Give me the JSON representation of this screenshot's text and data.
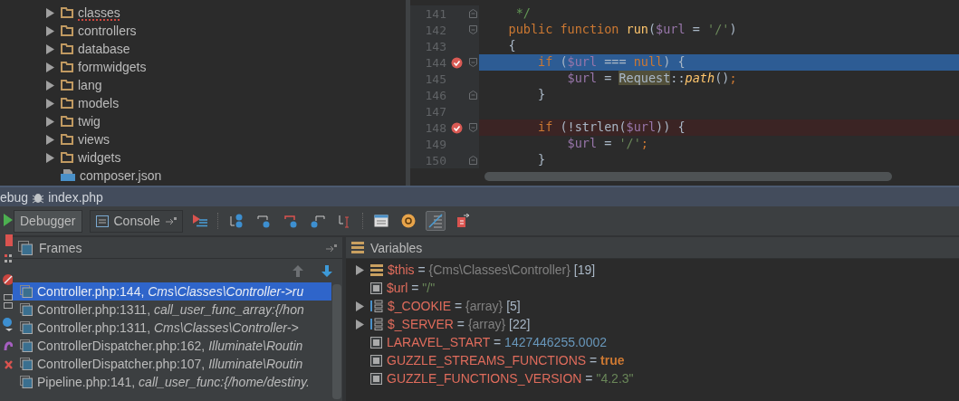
{
  "project_tree": {
    "items": [
      {
        "label": "classes",
        "kind": "folder",
        "misspelled": true
      },
      {
        "label": "controllers",
        "kind": "folder",
        "misspelled": false
      },
      {
        "label": "database",
        "kind": "folder",
        "misspelled": false
      },
      {
        "label": "formwidgets",
        "kind": "folder",
        "misspelled": false
      },
      {
        "label": "lang",
        "kind": "folder",
        "misspelled": false
      },
      {
        "label": "models",
        "kind": "folder",
        "misspelled": false
      },
      {
        "label": "twig",
        "kind": "folder",
        "misspelled": false
      },
      {
        "label": "views",
        "kind": "folder",
        "misspelled": false
      },
      {
        "label": "widgets",
        "kind": "folder",
        "misspelled": false
      },
      {
        "label": "composer.json",
        "kind": "json",
        "misspelled": false
      }
    ]
  },
  "editor": {
    "lines": [
      {
        "number": "141",
        "fold_start": false,
        "fold_end": true,
        "breakpoint": false,
        "current": false,
        "tokens": [
          {
            "kind": "comment",
            "text": "     */"
          }
        ]
      },
      {
        "number": "142",
        "fold_start": true,
        "fold_end": false,
        "breakpoint": false,
        "current": false,
        "tokens": [
          {
            "kind": "keyword",
            "text": "    public function "
          },
          {
            "kind": "func",
            "text": "run"
          },
          {
            "kind": "plain",
            "text": "("
          },
          {
            "kind": "var",
            "text": "$url"
          },
          {
            "kind": "plain",
            "text": " = "
          },
          {
            "kind": "string",
            "text": "'/'"
          },
          {
            "kind": "plain",
            "text": ")"
          }
        ]
      },
      {
        "number": "143",
        "fold_start": false,
        "fold_end": false,
        "breakpoint": false,
        "current": false,
        "tokens": [
          {
            "kind": "plain",
            "text": "    {"
          }
        ]
      },
      {
        "number": "144",
        "fold_start": true,
        "fold_end": false,
        "breakpoint": true,
        "current": true,
        "tokens": [
          {
            "kind": "keyword",
            "text": "        if"
          },
          {
            "kind": "plain",
            "text": " ("
          },
          {
            "kind": "var",
            "text": "$url"
          },
          {
            "kind": "plain",
            "text": " === "
          },
          {
            "kind": "keyword",
            "text": "null"
          },
          {
            "kind": "plain",
            "text": ") {"
          }
        ]
      },
      {
        "number": "145",
        "fold_start": false,
        "fold_end": false,
        "breakpoint": false,
        "current": false,
        "tokens": [
          {
            "kind": "var",
            "text": "            $url"
          },
          {
            "kind": "plain",
            "text": " = "
          },
          {
            "kind": "highlight",
            "text": "Request"
          },
          {
            "kind": "plain",
            "text": "::"
          },
          {
            "kind": "static",
            "text": "path"
          },
          {
            "kind": "plain",
            "text": "()"
          },
          {
            "kind": "keyword",
            "text": ";"
          }
        ]
      },
      {
        "number": "146",
        "fold_start": false,
        "fold_end": true,
        "breakpoint": false,
        "current": false,
        "tokens": [
          {
            "kind": "plain",
            "text": "        }"
          }
        ]
      },
      {
        "number": "147",
        "fold_start": false,
        "fold_end": false,
        "breakpoint": false,
        "current": false
      },
      {
        "number": "148",
        "fold_start": true,
        "fold_end": false,
        "breakpoint": true,
        "current": false,
        "tokens": [
          {
            "kind": "keyword",
            "text": "        if"
          },
          {
            "kind": "plain",
            "text": " (!strlen("
          },
          {
            "kind": "var",
            "text": "$url"
          },
          {
            "kind": "plain",
            "text": ")) {"
          }
        ]
      },
      {
        "number": "149",
        "fold_start": false,
        "fold_end": false,
        "breakpoint": false,
        "current": false,
        "tokens": [
          {
            "kind": "var",
            "text": "            $url"
          },
          {
            "kind": "plain",
            "text": " = "
          },
          {
            "kind": "string",
            "text": "'/'"
          },
          {
            "kind": "keyword",
            "text": ";"
          }
        ]
      },
      {
        "number": "150",
        "fold_start": false,
        "fold_end": true,
        "breakpoint": false,
        "current": false,
        "tokens": [
          {
            "kind": "plain",
            "text": "        }"
          }
        ]
      }
    ]
  },
  "debug_window": {
    "title": "ebug",
    "file": "index.php"
  },
  "tabs": [
    {
      "label": "Debugger",
      "kind": "plain",
      "selected": true
    },
    {
      "label": "Console",
      "kind": "console",
      "selected": false
    }
  ],
  "frames": {
    "title": "Frames",
    "items": [
      {
        "location": "Controller.php:144,",
        "call": "Cms\\Classes\\Controller->ru",
        "selected": true
      },
      {
        "location": "Controller.php:1311,",
        "call": "call_user_func_array:{/hon",
        "selected": false
      },
      {
        "location": "Controller.php:1311,",
        "call": "Cms\\Classes\\Controller->",
        "selected": false
      },
      {
        "location": "ControllerDispatcher.php:162,",
        "call": "Illuminate\\Routin",
        "selected": false
      },
      {
        "location": "ControllerDispatcher.php:107,",
        "call": "Illuminate\\Routin",
        "selected": false
      },
      {
        "location": "Pipeline.php:141,",
        "call": "call_user_func:{/home/destiny.",
        "selected": false
      }
    ]
  },
  "variables": {
    "title": "Variables",
    "items": [
      {
        "name": "$this",
        "kind": "object",
        "expandable": true,
        "separator": "=",
        "type": "{Cms\\Classes\\Controller}",
        "count": "[19]"
      },
      {
        "name": "$url",
        "kind": "string",
        "expandable": false,
        "separator": "=",
        "value": "\"/\""
      },
      {
        "name": "$_COOKIE",
        "kind": "array",
        "expandable": true,
        "separator": "=",
        "type": "{array}",
        "count": "[5]"
      },
      {
        "name": "$_SERVER",
        "kind": "array",
        "expandable": true,
        "separator": "=",
        "type": "{array}",
        "count": "[22]"
      },
      {
        "name": "LARAVEL_START",
        "kind": "number",
        "expandable": false,
        "separator": "=",
        "value": "1427446255.0002"
      },
      {
        "name": "GUZZLE_STREAMS_FUNCTIONS",
        "kind": "bool",
        "expandable": false,
        "separator": "=",
        "value": "true"
      },
      {
        "name": "GUZZLE_FUNCTIONS_VERSION",
        "kind": "string",
        "expandable": false,
        "separator": "=",
        "value": "\"4.2.3\""
      }
    ]
  }
}
